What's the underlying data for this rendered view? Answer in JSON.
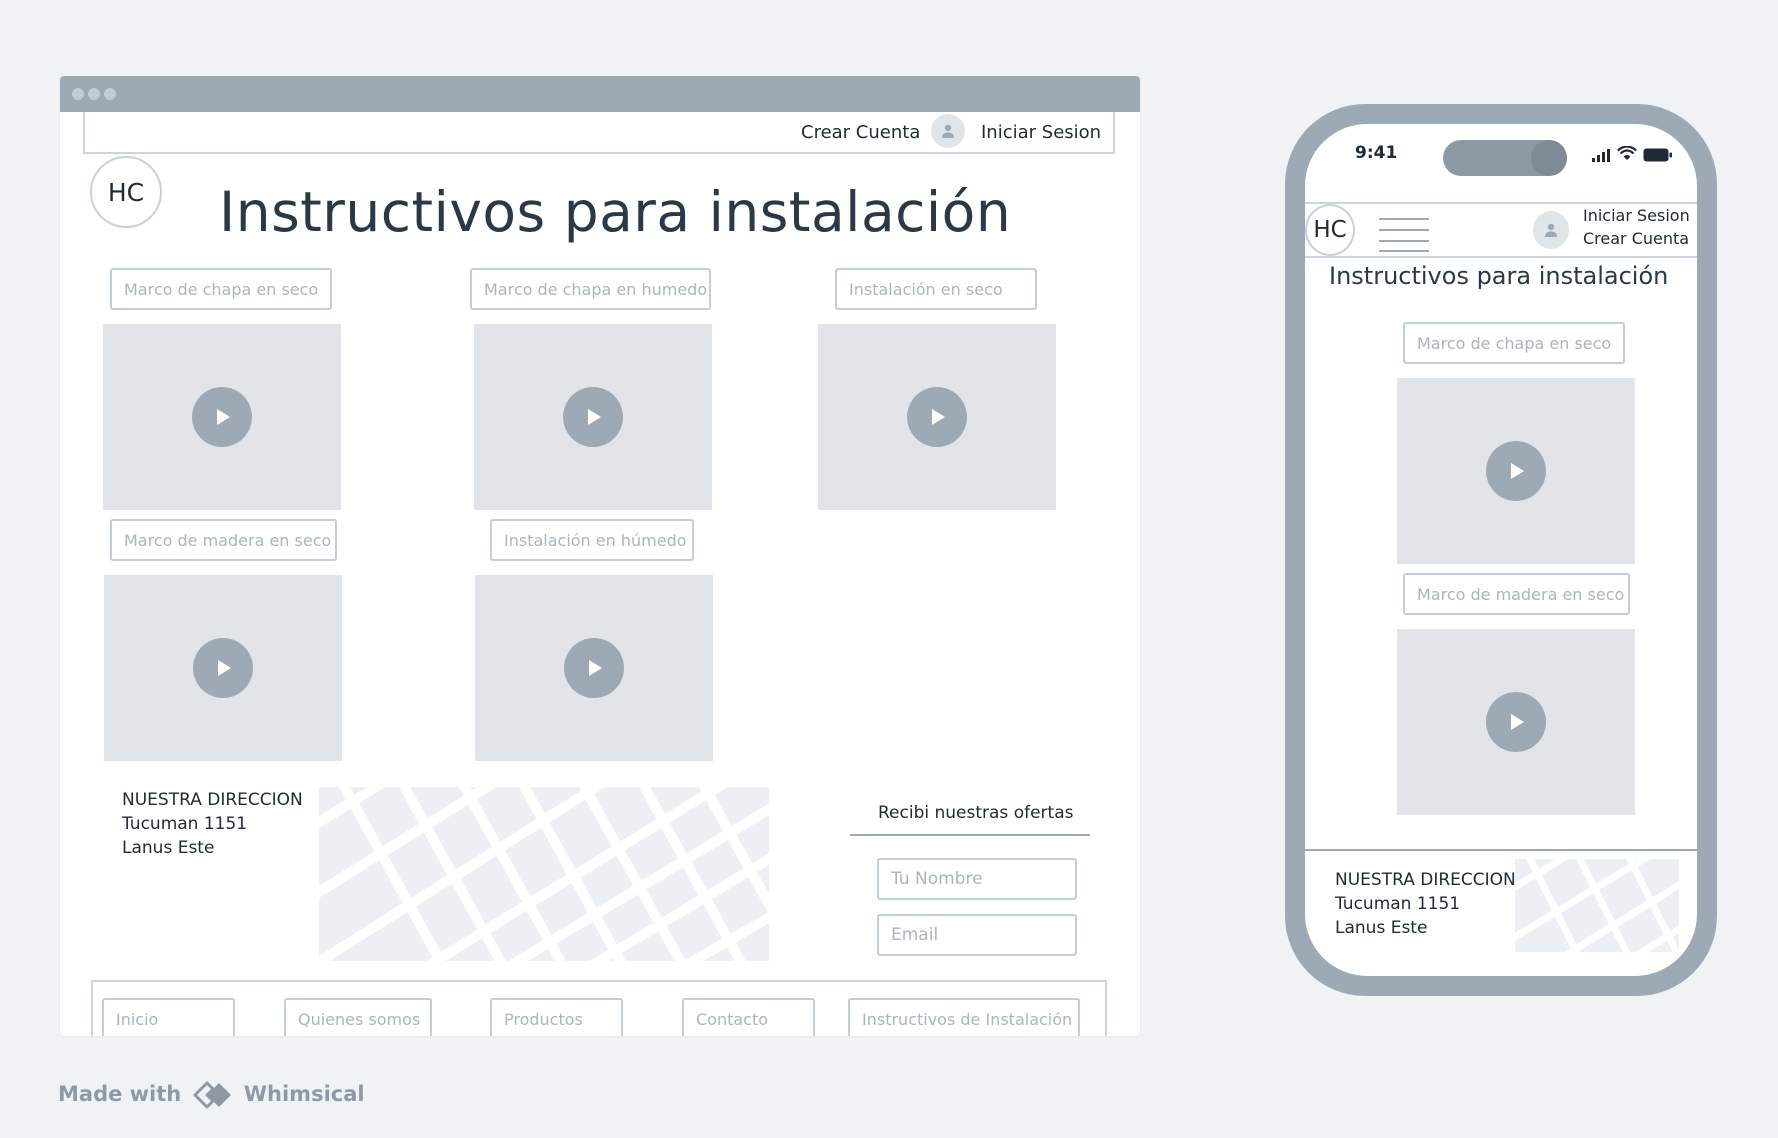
{
  "desktop": {
    "topnav": {
      "create_account": "Crear Cuenta",
      "sign_in": "Iniciar Sesion"
    },
    "logo": "HC",
    "title": "Instructivos para instalación",
    "videos": [
      {
        "label": "Marco de chapa en seco"
      },
      {
        "label": "Marco de chapa en humedo"
      },
      {
        "label": "Instalación en seco"
      },
      {
        "label": "Marco de madera en seco"
      },
      {
        "label": "Instalación en húmedo"
      }
    ],
    "address": {
      "heading": "NUESTRA DIRECCION",
      "street": "Tucuman 1151",
      "city": "Lanus Este"
    },
    "newsletter": {
      "title": "Recibi nuestras ofertas",
      "name_placeholder": "Tu Nombre",
      "email_placeholder": "Email"
    },
    "footer": [
      "Inicio",
      "Quienes somos",
      "Productos",
      "Contacto",
      "Instructivos de Instalación"
    ]
  },
  "mobile": {
    "status_time": "9:41",
    "logo": "HC",
    "sign_in": "Iniciar Sesion",
    "create_account": "Crear Cuenta",
    "title": "Instructivos para instalación",
    "videos": [
      {
        "label": "Marco de chapa en seco"
      },
      {
        "label": "Marco de madera en seco"
      }
    ],
    "address": {
      "heading": "NUESTRA DIRECCION",
      "street": "Tucuman 1151",
      "city": "Lanus Este"
    }
  },
  "watermark": {
    "prefix": "Made with",
    "brand": "Whimsical"
  },
  "colors": {
    "frame": "#9daab6",
    "placeholder": "#e1e5ea",
    "border": "#c4ced8",
    "text": "#1e2a36"
  }
}
